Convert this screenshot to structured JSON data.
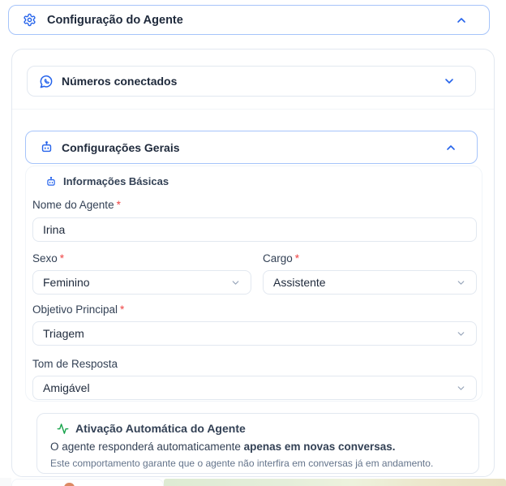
{
  "ui": {
    "required_marker": "*"
  },
  "colors": {
    "accent_blue": "#2563eb",
    "accent_blue_border": "#a6c4fa",
    "success_green": "#16a34a",
    "required_red": "#ef4444",
    "card_border": "#e2e8f0",
    "muted_text": "#64748b"
  },
  "agent_config_header": {
    "title": "Configuração do Agente",
    "state": "expanded"
  },
  "numbers_section": {
    "title": "Números conectados",
    "state": "collapsed"
  },
  "general_section": {
    "title": "Configurações Gerais",
    "state": "expanded"
  },
  "basic_info": {
    "section_title": "Informações Básicas",
    "fields": {
      "name": {
        "label": "Nome do Agente",
        "required": true,
        "value": "Irina"
      },
      "sex": {
        "label": "Sexo",
        "required": true,
        "value": "Feminino"
      },
      "role": {
        "label": "Cargo",
        "required": true,
        "value": "Assistente"
      },
      "objective": {
        "label": "Objetivo Principal",
        "required": true,
        "value": "Triagem"
      },
      "tone": {
        "label": "Tom de Resposta",
        "required": false,
        "value": "Amigável"
      }
    }
  },
  "auto_activation": {
    "title": "Ativação Automática do Agente",
    "description_normal": "O agente responderá automaticamente ",
    "description_bold": "apenas em novas conversas.",
    "note": "Este comportamento garante que o agente não interfira em conversas já em andamento."
  }
}
